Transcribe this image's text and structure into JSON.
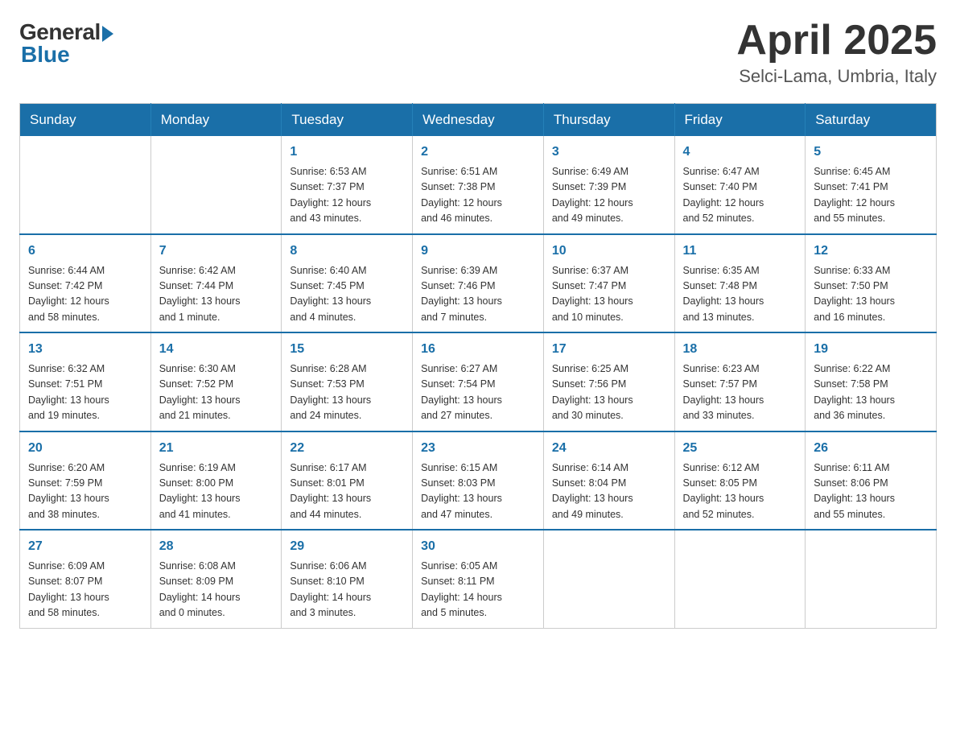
{
  "header": {
    "logo_general": "General",
    "logo_blue": "Blue",
    "month_title": "April 2025",
    "location": "Selci-Lama, Umbria, Italy"
  },
  "days_of_week": [
    "Sunday",
    "Monday",
    "Tuesday",
    "Wednesday",
    "Thursday",
    "Friday",
    "Saturday"
  ],
  "weeks": [
    [
      {
        "day": "",
        "info": ""
      },
      {
        "day": "",
        "info": ""
      },
      {
        "day": "1",
        "info": "Sunrise: 6:53 AM\nSunset: 7:37 PM\nDaylight: 12 hours\nand 43 minutes."
      },
      {
        "day": "2",
        "info": "Sunrise: 6:51 AM\nSunset: 7:38 PM\nDaylight: 12 hours\nand 46 minutes."
      },
      {
        "day": "3",
        "info": "Sunrise: 6:49 AM\nSunset: 7:39 PM\nDaylight: 12 hours\nand 49 minutes."
      },
      {
        "day": "4",
        "info": "Sunrise: 6:47 AM\nSunset: 7:40 PM\nDaylight: 12 hours\nand 52 minutes."
      },
      {
        "day": "5",
        "info": "Sunrise: 6:45 AM\nSunset: 7:41 PM\nDaylight: 12 hours\nand 55 minutes."
      }
    ],
    [
      {
        "day": "6",
        "info": "Sunrise: 6:44 AM\nSunset: 7:42 PM\nDaylight: 12 hours\nand 58 minutes."
      },
      {
        "day": "7",
        "info": "Sunrise: 6:42 AM\nSunset: 7:44 PM\nDaylight: 13 hours\nand 1 minute."
      },
      {
        "day": "8",
        "info": "Sunrise: 6:40 AM\nSunset: 7:45 PM\nDaylight: 13 hours\nand 4 minutes."
      },
      {
        "day": "9",
        "info": "Sunrise: 6:39 AM\nSunset: 7:46 PM\nDaylight: 13 hours\nand 7 minutes."
      },
      {
        "day": "10",
        "info": "Sunrise: 6:37 AM\nSunset: 7:47 PM\nDaylight: 13 hours\nand 10 minutes."
      },
      {
        "day": "11",
        "info": "Sunrise: 6:35 AM\nSunset: 7:48 PM\nDaylight: 13 hours\nand 13 minutes."
      },
      {
        "day": "12",
        "info": "Sunrise: 6:33 AM\nSunset: 7:50 PM\nDaylight: 13 hours\nand 16 minutes."
      }
    ],
    [
      {
        "day": "13",
        "info": "Sunrise: 6:32 AM\nSunset: 7:51 PM\nDaylight: 13 hours\nand 19 minutes."
      },
      {
        "day": "14",
        "info": "Sunrise: 6:30 AM\nSunset: 7:52 PM\nDaylight: 13 hours\nand 21 minutes."
      },
      {
        "day": "15",
        "info": "Sunrise: 6:28 AM\nSunset: 7:53 PM\nDaylight: 13 hours\nand 24 minutes."
      },
      {
        "day": "16",
        "info": "Sunrise: 6:27 AM\nSunset: 7:54 PM\nDaylight: 13 hours\nand 27 minutes."
      },
      {
        "day": "17",
        "info": "Sunrise: 6:25 AM\nSunset: 7:56 PM\nDaylight: 13 hours\nand 30 minutes."
      },
      {
        "day": "18",
        "info": "Sunrise: 6:23 AM\nSunset: 7:57 PM\nDaylight: 13 hours\nand 33 minutes."
      },
      {
        "day": "19",
        "info": "Sunrise: 6:22 AM\nSunset: 7:58 PM\nDaylight: 13 hours\nand 36 minutes."
      }
    ],
    [
      {
        "day": "20",
        "info": "Sunrise: 6:20 AM\nSunset: 7:59 PM\nDaylight: 13 hours\nand 38 minutes."
      },
      {
        "day": "21",
        "info": "Sunrise: 6:19 AM\nSunset: 8:00 PM\nDaylight: 13 hours\nand 41 minutes."
      },
      {
        "day": "22",
        "info": "Sunrise: 6:17 AM\nSunset: 8:01 PM\nDaylight: 13 hours\nand 44 minutes."
      },
      {
        "day": "23",
        "info": "Sunrise: 6:15 AM\nSunset: 8:03 PM\nDaylight: 13 hours\nand 47 minutes."
      },
      {
        "day": "24",
        "info": "Sunrise: 6:14 AM\nSunset: 8:04 PM\nDaylight: 13 hours\nand 49 minutes."
      },
      {
        "day": "25",
        "info": "Sunrise: 6:12 AM\nSunset: 8:05 PM\nDaylight: 13 hours\nand 52 minutes."
      },
      {
        "day": "26",
        "info": "Sunrise: 6:11 AM\nSunset: 8:06 PM\nDaylight: 13 hours\nand 55 minutes."
      }
    ],
    [
      {
        "day": "27",
        "info": "Sunrise: 6:09 AM\nSunset: 8:07 PM\nDaylight: 13 hours\nand 58 minutes."
      },
      {
        "day": "28",
        "info": "Sunrise: 6:08 AM\nSunset: 8:09 PM\nDaylight: 14 hours\nand 0 minutes."
      },
      {
        "day": "29",
        "info": "Sunrise: 6:06 AM\nSunset: 8:10 PM\nDaylight: 14 hours\nand 3 minutes."
      },
      {
        "day": "30",
        "info": "Sunrise: 6:05 AM\nSunset: 8:11 PM\nDaylight: 14 hours\nand 5 minutes."
      },
      {
        "day": "",
        "info": ""
      },
      {
        "day": "",
        "info": ""
      },
      {
        "day": "",
        "info": ""
      }
    ]
  ]
}
